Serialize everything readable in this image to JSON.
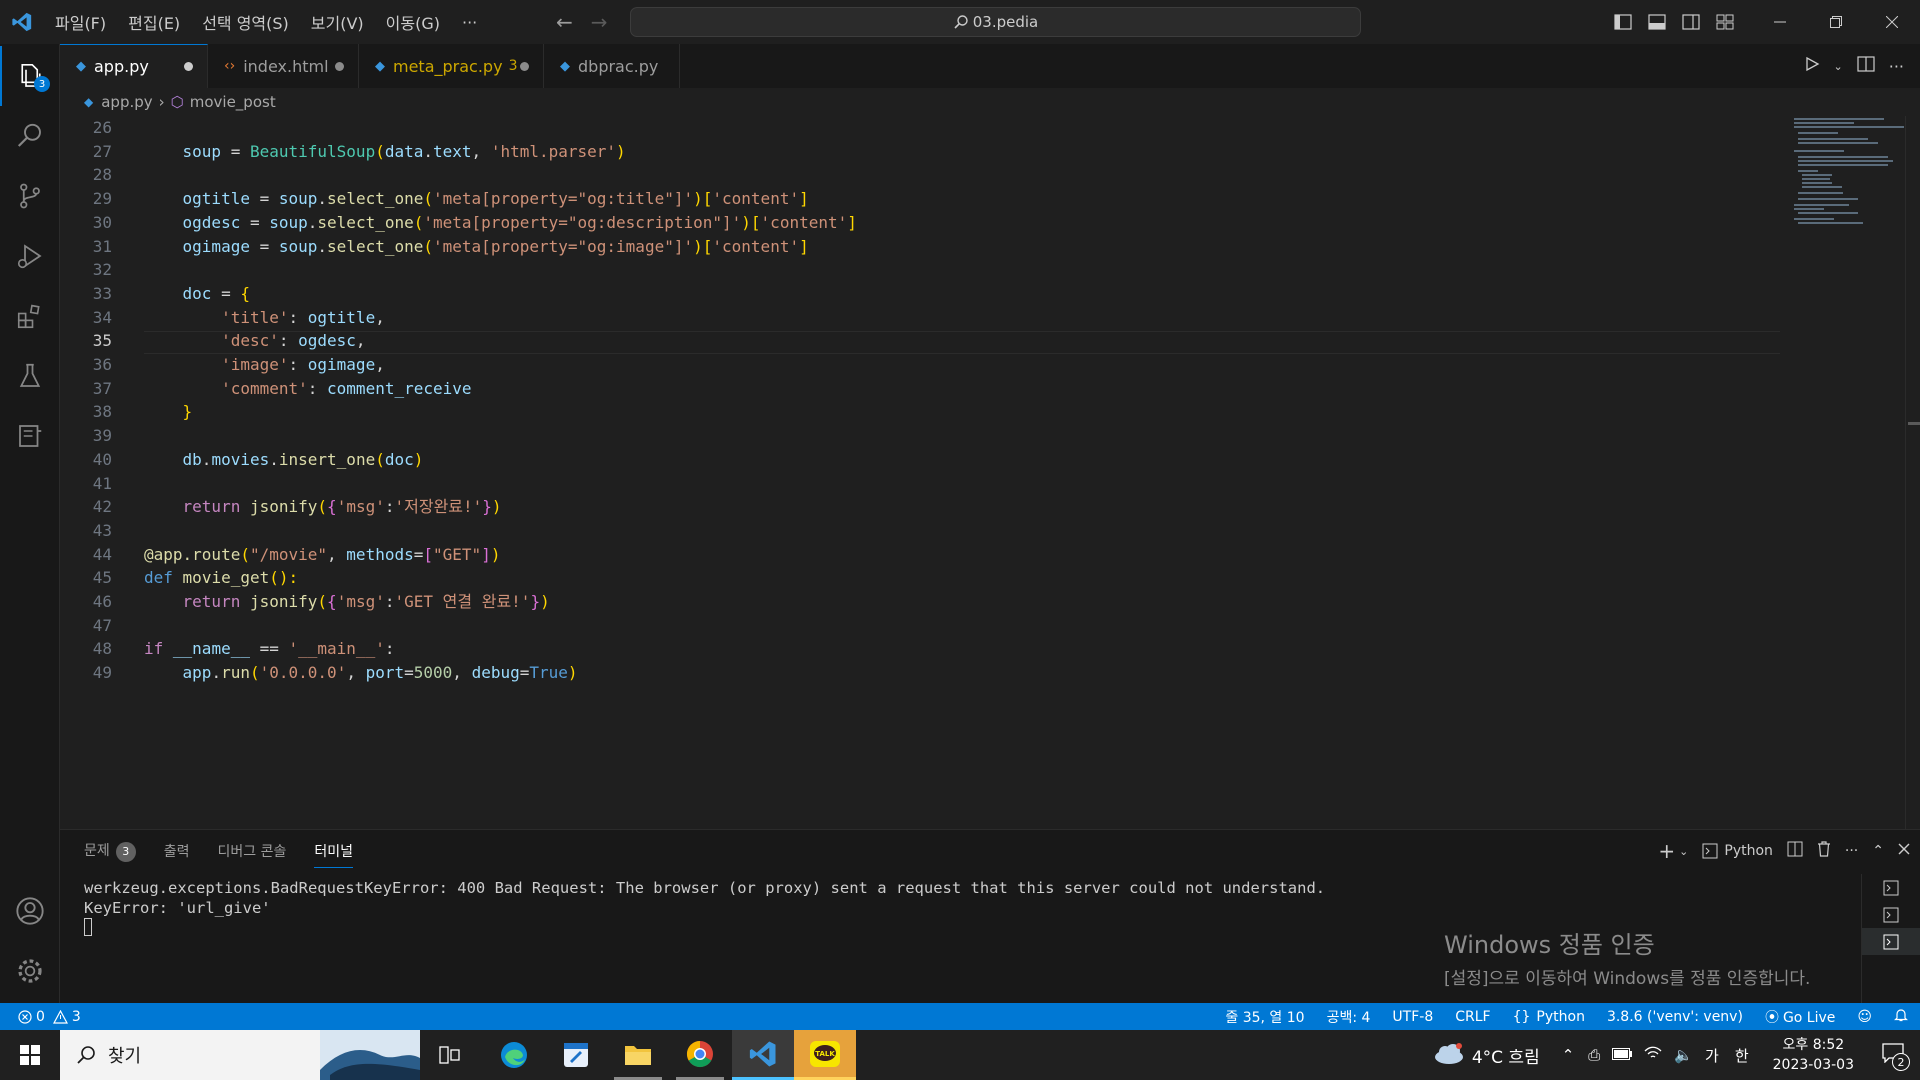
{
  "menu": [
    "파일(F)",
    "편집(E)",
    "선택 영역(S)",
    "보기(V)",
    "이동(G)",
    "···"
  ],
  "command_center": "03.pedia",
  "activity": {
    "explorer_badge": "3"
  },
  "tabs": [
    {
      "label": "app.py",
      "icon": "python-icon",
      "modified": true,
      "active": true
    },
    {
      "label": "index.html",
      "icon": "html-icon",
      "modified": true,
      "active": false
    },
    {
      "label": "meta_prac.py",
      "badge": "3",
      "icon": "python-icon",
      "modified": true,
      "active": false
    },
    {
      "label": "dbprac.py",
      "icon": "python-icon",
      "modified": false,
      "active": false
    }
  ],
  "breadcrumb": {
    "file": "app.py",
    "symbol": "movie_post"
  },
  "editor": {
    "current_line": 35,
    "lines": [
      {
        "n": "26",
        "tokens": []
      },
      {
        "n": "27",
        "tokens": [
          [
            "    ",
            ""
          ],
          [
            "soup",
            "var"
          ],
          [
            " = ",
            "op"
          ],
          [
            "BeautifulSoup",
            "cls"
          ],
          [
            "(",
            "br1"
          ],
          [
            "data",
            "var"
          ],
          [
            ".",
            "op"
          ],
          [
            "text",
            "var"
          ],
          [
            ", ",
            "op"
          ],
          [
            "'html.parser'",
            "str"
          ],
          [
            ")",
            "br1"
          ]
        ]
      },
      {
        "n": "28",
        "tokens": []
      },
      {
        "n": "29",
        "tokens": [
          [
            "    ",
            ""
          ],
          [
            "ogtitle",
            "var"
          ],
          [
            " = ",
            "op"
          ],
          [
            "soup",
            "var"
          ],
          [
            ".",
            "op"
          ],
          [
            "select_one",
            "fn"
          ],
          [
            "(",
            "br1"
          ],
          [
            "'meta[property=\"og:title\"]'",
            "str"
          ],
          [
            ")",
            "br1"
          ],
          [
            "[",
            "br1"
          ],
          [
            "'content'",
            "str"
          ],
          [
            "]",
            "br1"
          ]
        ]
      },
      {
        "n": "30",
        "tokens": [
          [
            "    ",
            ""
          ],
          [
            "ogdesc",
            "var"
          ],
          [
            " = ",
            "op"
          ],
          [
            "soup",
            "var"
          ],
          [
            ".",
            "op"
          ],
          [
            "select_one",
            "fn"
          ],
          [
            "(",
            "br1"
          ],
          [
            "'meta[property=\"og:description\"]'",
            "str"
          ],
          [
            ")",
            "br1"
          ],
          [
            "[",
            "br1"
          ],
          [
            "'content'",
            "str"
          ],
          [
            "]",
            "br1"
          ]
        ]
      },
      {
        "n": "31",
        "tokens": [
          [
            "    ",
            ""
          ],
          [
            "ogimage",
            "var"
          ],
          [
            " = ",
            "op"
          ],
          [
            "soup",
            "var"
          ],
          [
            ".",
            "op"
          ],
          [
            "select_one",
            "fn"
          ],
          [
            "(",
            "br1"
          ],
          [
            "'meta[property=\"og:image\"]'",
            "str"
          ],
          [
            ")",
            "br1"
          ],
          [
            "[",
            "br1"
          ],
          [
            "'content'",
            "str"
          ],
          [
            "]",
            "br1"
          ]
        ]
      },
      {
        "n": "32",
        "tokens": []
      },
      {
        "n": "33",
        "tokens": [
          [
            "    ",
            ""
          ],
          [
            "doc",
            "var"
          ],
          [
            " = ",
            "op"
          ],
          [
            "{",
            "br1"
          ]
        ]
      },
      {
        "n": "34",
        "tokens": [
          [
            "        ",
            ""
          ],
          [
            "'title'",
            "str"
          ],
          [
            ": ",
            "op"
          ],
          [
            "ogtitle",
            "var"
          ],
          [
            ",",
            "op"
          ]
        ]
      },
      {
        "n": "35",
        "tokens": [
          [
            "        ",
            ""
          ],
          [
            "'desc'",
            "str"
          ],
          [
            ": ",
            "op"
          ],
          [
            "ogdesc",
            "var"
          ],
          [
            ",",
            "op"
          ]
        ]
      },
      {
        "n": "36",
        "tokens": [
          [
            "        ",
            ""
          ],
          [
            "'image'",
            "str"
          ],
          [
            ": ",
            "op"
          ],
          [
            "ogimage",
            "var"
          ],
          [
            ",",
            "op"
          ]
        ]
      },
      {
        "n": "37",
        "tokens": [
          [
            "        ",
            ""
          ],
          [
            "'comment'",
            "str"
          ],
          [
            ": ",
            "op"
          ],
          [
            "comment_receive",
            "var"
          ]
        ]
      },
      {
        "n": "38",
        "tokens": [
          [
            "    ",
            ""
          ],
          [
            "}",
            "br1"
          ]
        ]
      },
      {
        "n": "39",
        "tokens": []
      },
      {
        "n": "40",
        "tokens": [
          [
            "    ",
            ""
          ],
          [
            "db",
            "var"
          ],
          [
            ".",
            "op"
          ],
          [
            "movies",
            "var"
          ],
          [
            ".",
            "op"
          ],
          [
            "insert_one",
            "fn"
          ],
          [
            "(",
            "br1"
          ],
          [
            "doc",
            "var"
          ],
          [
            ")",
            "br1"
          ]
        ]
      },
      {
        "n": "41",
        "tokens": []
      },
      {
        "n": "42",
        "tokens": [
          [
            "    ",
            ""
          ],
          [
            "return",
            "ctrl"
          ],
          [
            " ",
            ""
          ],
          [
            "jsonify",
            "fn"
          ],
          [
            "(",
            "br1"
          ],
          [
            "{",
            "br2"
          ],
          [
            "'msg'",
            "str"
          ],
          [
            ":",
            "op"
          ],
          [
            "'저장완료!'",
            "str"
          ],
          [
            "}",
            "br2"
          ],
          [
            ")",
            "br1"
          ]
        ]
      },
      {
        "n": "43",
        "tokens": []
      },
      {
        "n": "44",
        "tokens": [
          [
            "@app.route",
            "fn"
          ],
          [
            "(",
            "br1"
          ],
          [
            "\"/movie\"",
            "str"
          ],
          [
            ", ",
            "op"
          ],
          [
            "methods",
            "var"
          ],
          [
            "=",
            "op"
          ],
          [
            "[",
            "br2"
          ],
          [
            "\"GET\"",
            "str"
          ],
          [
            "]",
            "br2"
          ],
          [
            ")",
            "br1"
          ]
        ]
      },
      {
        "n": "45",
        "tokens": [
          [
            "def",
            "kw"
          ],
          [
            " ",
            ""
          ],
          [
            "movie_get",
            "fn"
          ],
          [
            "():",
            "br1"
          ]
        ]
      },
      {
        "n": "46",
        "tokens": [
          [
            "    ",
            ""
          ],
          [
            "return",
            "ctrl"
          ],
          [
            " ",
            ""
          ],
          [
            "jsonify",
            "fn"
          ],
          [
            "(",
            "br1"
          ],
          [
            "{",
            "br2"
          ],
          [
            "'msg'",
            "str"
          ],
          [
            ":",
            "op"
          ],
          [
            "'GET 연결 완료!'",
            "str"
          ],
          [
            "}",
            "br2"
          ],
          [
            ")",
            "br1"
          ]
        ]
      },
      {
        "n": "47",
        "tokens": []
      },
      {
        "n": "48",
        "tokens": [
          [
            "if",
            "ctrl"
          ],
          [
            " ",
            ""
          ],
          [
            "__name__",
            "var"
          ],
          [
            " == ",
            "op"
          ],
          [
            "'__main__'",
            "str"
          ],
          [
            ":",
            "op"
          ]
        ]
      },
      {
        "n": "49",
        "tokens": [
          [
            "    ",
            ""
          ],
          [
            "app",
            "var"
          ],
          [
            ".",
            "op"
          ],
          [
            "run",
            "fn"
          ],
          [
            "(",
            "br1"
          ],
          [
            "'0.0.0.0'",
            "str"
          ],
          [
            ", ",
            "op"
          ],
          [
            "port",
            "var"
          ],
          [
            "=",
            "op"
          ],
          [
            "5000",
            "num"
          ],
          [
            ", ",
            "op"
          ],
          [
            "debug",
            "var"
          ],
          [
            "=",
            "op"
          ],
          [
            "True",
            "kw"
          ],
          [
            ")",
            "br1"
          ]
        ]
      }
    ]
  },
  "panel": {
    "tabs": [
      {
        "label": "문제",
        "count": "3"
      },
      {
        "label": "출력"
      },
      {
        "label": "디버그 콘솔"
      },
      {
        "label": "터미널",
        "active": true
      }
    ],
    "terminal_profile": "Python",
    "terminal_lines": [
      "werkzeug.exceptions.BadRequestKeyError: 400 Bad Request: The browser (or proxy) sent a request that this server could not understand.",
      "KeyError: 'url_give'"
    ]
  },
  "watermark": {
    "title": "Windows 정품 인증",
    "subtitle": "[설정]으로 이동하여 Windows를 정품 인증합니다."
  },
  "status": {
    "errors": "0",
    "warnings": "3",
    "position": "줄 35, 열 10",
    "spaces": "공백: 4",
    "encoding": "UTF-8",
    "eol": "CRLF",
    "language": "Python",
    "interpreter": "3.8.6 ('venv': venv)",
    "golive": "Go Live"
  },
  "taskbar": {
    "search": "찾기",
    "weather": "4°C 흐림",
    "ime1": "가",
    "ime2": "한",
    "time": "오후 8:52",
    "date": "2023-03-03",
    "notifications": "2"
  },
  "colors": {
    "accent": "#0078d4",
    "editor_bg": "#1f1f1f",
    "statusbar": "#0078d4"
  }
}
